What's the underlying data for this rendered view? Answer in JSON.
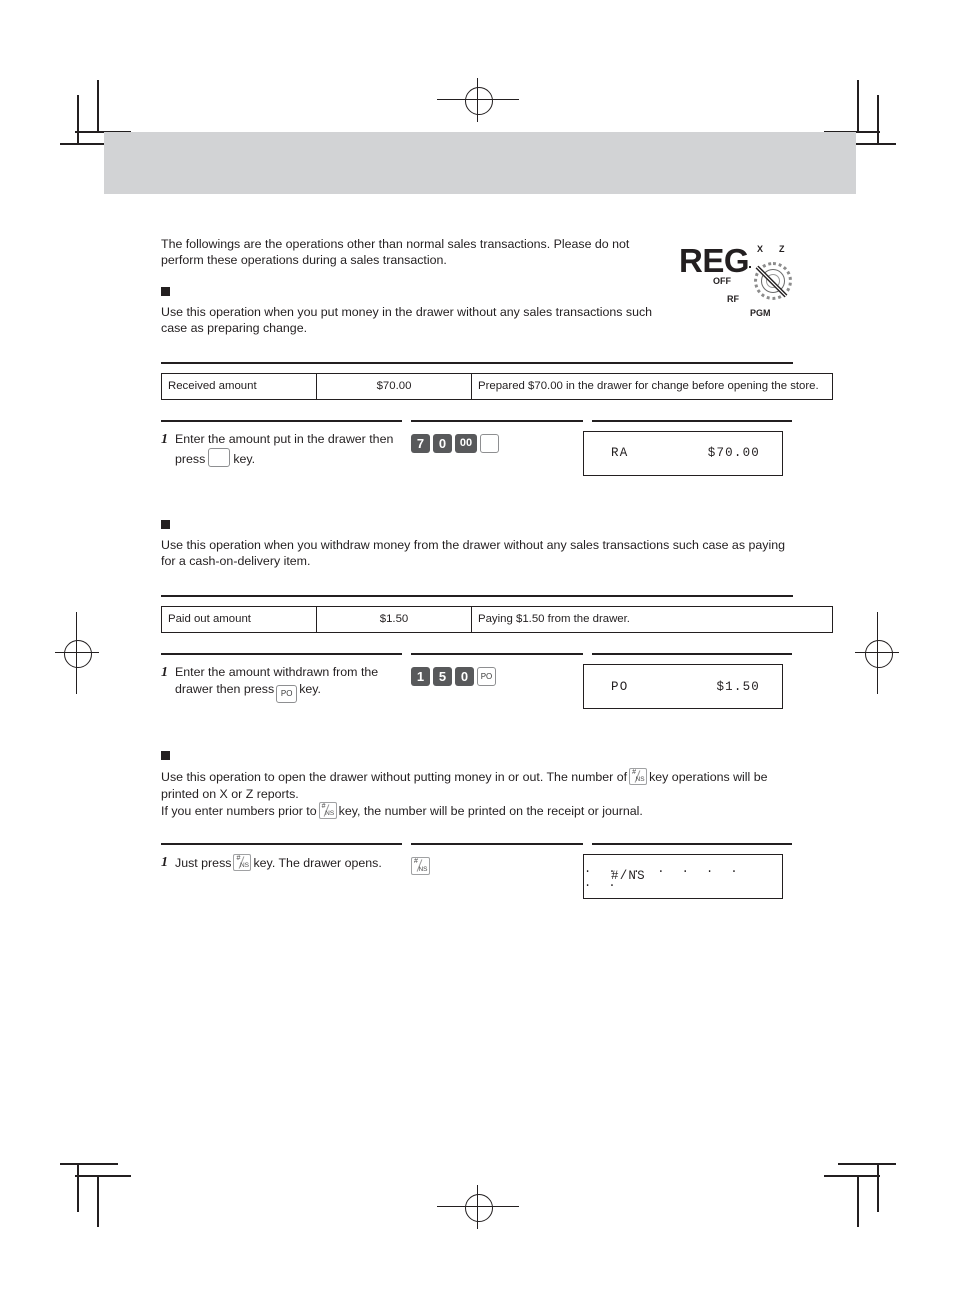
{
  "page": {
    "intro": "The followings are the operations other than normal sales transactions. Please do not perform these operations during a sales transaction."
  },
  "mode_dial": {
    "name": "reg-mode-dial",
    "selected": "REG",
    "positions": [
      "X",
      "Z",
      "OFF",
      "RF",
      "PGM"
    ],
    "label_x": "X",
    "label_z": "Z",
    "label_off": "OFF",
    "label_rf": "RF",
    "label_pgm": "PGM"
  },
  "sections": [
    {
      "id": "received-on-account",
      "heading": "",
      "body": "Use this operation when you put money in the drawer without any sales transactions such case as preparing change.",
      "table": {
        "label": "Received amount",
        "amount": "$70.00",
        "note": "Prepared $70.00 in the drawer for change before opening the store."
      },
      "step": {
        "number": "1",
        "text_before": "Enter the amount put in the drawer then press",
        "text_after": "key.",
        "keys": [
          {
            "label": "7",
            "style": "dark"
          },
          {
            "label": "0",
            "style": "dark"
          },
          {
            "label": "00",
            "style": "dark-wide"
          },
          {
            "label": "",
            "style": "blank"
          }
        ],
        "display": {
          "left": "RA",
          "right": "$70.00"
        }
      }
    },
    {
      "id": "paid-out",
      "heading": "",
      "body": "Use this operation when you withdraw money from the drawer without any sales transactions such case as paying for a cash-on-delivery item.",
      "table": {
        "label": "Paid out amount",
        "amount": "$1.50",
        "note": "Paying $1.50 from the drawer."
      },
      "step": {
        "number": "1",
        "text_before": "Enter the amount withdrawn from the drawer then press",
        "text_after": "key.",
        "inline_key": "PO",
        "keys": [
          {
            "label": "1",
            "style": "dark"
          },
          {
            "label": "5",
            "style": "dark"
          },
          {
            "label": "0",
            "style": "dark"
          },
          {
            "label": "PO",
            "style": "light"
          }
        ],
        "display": {
          "left": "PO",
          "right": "$1.50"
        }
      }
    },
    {
      "id": "no-sale",
      "heading": "",
      "body_part1": "Use this operation to open the drawer without putting money in or out. The number of",
      "body_part2": "key operations will be printed on X or Z reports.",
      "body_part3": "If you enter numbers prior to",
      "body_part4": "key, the number will be printed on the receipt or journal.",
      "step": {
        "number": "1",
        "text_before": "Just press",
        "text_after": "key. The drawer opens.",
        "keys": [
          {
            "label": "#/NS",
            "style": "ns"
          }
        ],
        "display": {
          "left": "#/NS",
          "right": ". . . . . . . . ."
        }
      }
    }
  ],
  "colors": {
    "header_band": "#d2d3d5",
    "key_dark": "#58595b",
    "ink": "#231f20"
  }
}
